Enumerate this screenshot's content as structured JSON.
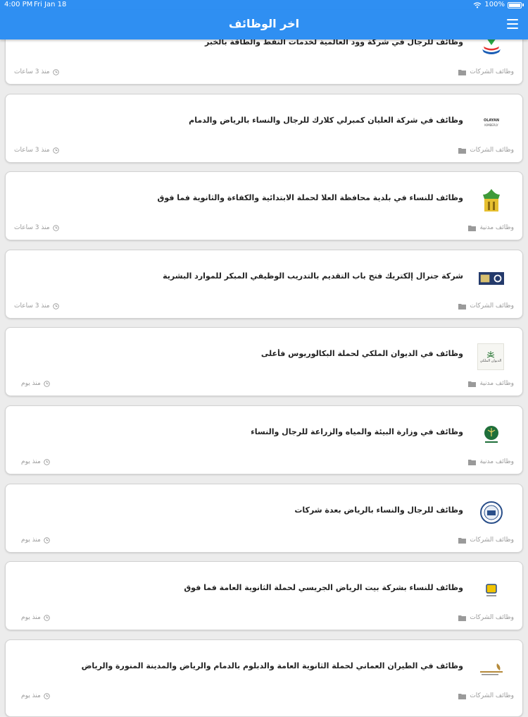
{
  "status_bar": {
    "time": "4:00 PM",
    "date": "Fri Jan 18",
    "battery": "100%"
  },
  "app_bar": {
    "title": "اخر الوظائف",
    "menu_icon": "hamburger-menu-icon"
  },
  "jobs": [
    {
      "title": "وظائف للرجال في شركة وود العالمية لخدمات النفط والطاقة بالخبر",
      "category": "وظائف الشركات",
      "time": "منذ 3 ساعات",
      "logo": "kuwait-petroleum-logo"
    },
    {
      "title": "وظائف في شركة العليان كمبرلي كلارك للرجال والنساء بالرياض والدمام",
      "category": "وظائف الشركات",
      "time": "منذ 3 ساعات",
      "logo": "olayan-kimberly-logo"
    },
    {
      "title": "وظائف للنساء في بلدية محافظة العلا لحملة الابتدائية والكفاءة والثانوية فما فوق",
      "category": "وظائف مدنية",
      "time": "منذ 3 ساعات",
      "logo": "alula-municipality-logo"
    },
    {
      "title": "شركة جنرال إلكتريك فتح باب التقديم بالتدريب الوظيفي المبكر للموارد البشرية",
      "category": "وظائف الشركات",
      "time": "منذ 3 ساعات",
      "logo": "general-electric-banner"
    },
    {
      "title": "وظائف في الديوان الملكي لحملة البكالوريوس فأعلى",
      "category": "وظائف مدنية",
      "time": "منذ يوم",
      "logo": "royal-court-logo",
      "logo_text": "الديوان الملكي"
    },
    {
      "title": "وظائف في وزارة البيئة والمياه والزراعة للرجال والنساء",
      "category": "وظائف مدنية",
      "time": "منذ يوم",
      "logo": "environment-ministry-logo"
    },
    {
      "title": "وظائف للرجال والنساء بالرياض بعدة شركات",
      "category": "وظائف الشركات",
      "time": "منذ يوم",
      "logo": "company-seal-logo"
    },
    {
      "title": "وظائف للنساء بشركة بيت الرياض الجريسي لحملة الثانوية العامة فما فوق",
      "category": "وظائف الشركات",
      "time": "منذ يوم",
      "logo": "juraisy-logo"
    },
    {
      "title": "وظائف في الطيران العماني لحملة الثانوية العامة والدبلوم بالدمام والرياض والمدينة المنورة والرياض",
      "category": "وظائف الشركات",
      "time": "منذ يوم",
      "logo": "oman-air-logo"
    }
  ],
  "colors": {
    "primary": "#2f8ff2",
    "meta": "#9a9a9a",
    "background": "#ececec"
  }
}
